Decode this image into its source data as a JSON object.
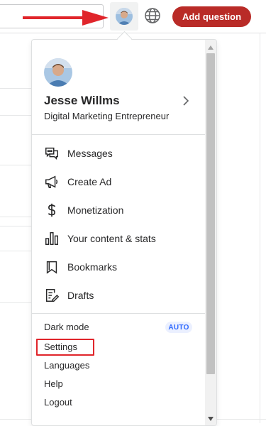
{
  "header": {
    "add_question_label": "Add question",
    "avatar_icon": "user-avatar",
    "globe_icon": "globe-icon",
    "arrow_annotation_color": "#e0252b"
  },
  "dropdown": {
    "profile": {
      "name": "Jesse Willms",
      "tagline": "Digital Marketing Entrepreneur",
      "chevron_icon": "chevron-right-icon"
    },
    "menu_items": [
      {
        "label": "Messages",
        "icon": "message-icon"
      },
      {
        "label": "Create Ad",
        "icon": "megaphone-icon"
      },
      {
        "label": "Monetization",
        "icon": "dollar-icon"
      },
      {
        "label": "Your content & stats",
        "icon": "bar-chart-icon"
      },
      {
        "label": "Bookmarks",
        "icon": "bookmark-icon"
      },
      {
        "label": "Drafts",
        "icon": "drafts-icon"
      }
    ],
    "secondary_items": [
      {
        "label": "Dark mode",
        "badge": "AUTO"
      },
      {
        "label": "Settings",
        "highlighted": true
      },
      {
        "label": "Languages"
      },
      {
        "label": "Help"
      },
      {
        "label": "Logout"
      }
    ]
  },
  "colors": {
    "brand_red": "#b92b27",
    "highlight_red": "#e0252b",
    "badge_blue": "#2e69ff",
    "badge_bg": "#ebf0ff"
  }
}
